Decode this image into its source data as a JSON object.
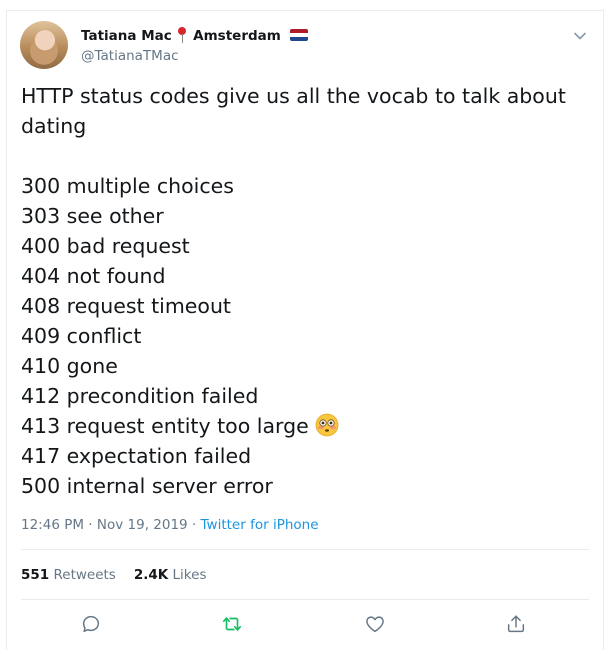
{
  "tweet": {
    "author_name": "Tatiana Mac",
    "location": "Amsterdam",
    "handle": "@TatianaTMac",
    "intro_line1": "HTTP status codes give us all the vocab to talk about",
    "intro_line2": "dating",
    "codes": [
      "300 multiple choices",
      "303 see other",
      "400 bad request",
      "404 not found",
      "408 request timeout",
      "409 conflict",
      "410 gone",
      "412 precondition failed",
      "413 request entity too large",
      "417 expectation failed",
      "500 internal server error"
    ],
    "emoji_after_code_index": 8,
    "time": "12:46 PM",
    "separator": "·",
    "date": "Nov 19, 2019",
    "source": "Twitter for iPhone",
    "retweets_count": "551",
    "retweets_label": "Retweets",
    "likes_count": "2.4K",
    "likes_label": "Likes"
  },
  "icons": {
    "reply": "speech-bubble-icon",
    "retweet": "retweet-icon",
    "like": "heart-icon",
    "share": "share-icon",
    "more": "chevron-down-icon",
    "location": "round-pushpin-icon",
    "flag": "netherlands-flag-icon",
    "emoji": "flushed-face-icon"
  },
  "colors": {
    "text": "#14171a",
    "secondary": "#657786",
    "link": "#1b95e0",
    "retweet_green": "#17bf63",
    "border": "#e6ecf0"
  }
}
